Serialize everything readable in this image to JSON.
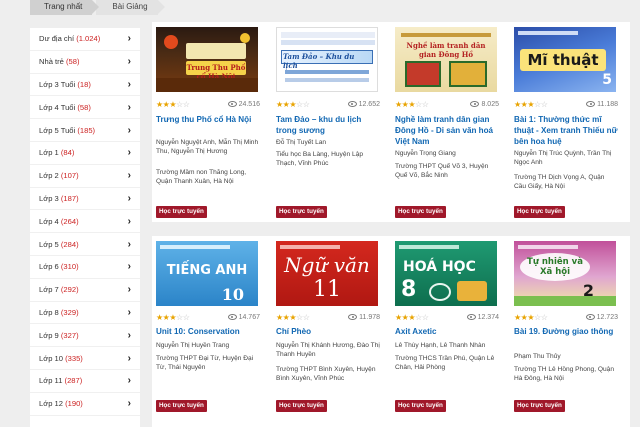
{
  "breadcrumb": {
    "home": "Trang nhất",
    "current": "Bài Giảng"
  },
  "sidebar": {
    "items": [
      {
        "label": "Dư địa chí",
        "count": "(1.024)"
      },
      {
        "label": "Nhà trẻ",
        "count": "(58)"
      },
      {
        "label": "Lớp 3 Tuổi",
        "count": "(18)"
      },
      {
        "label": "Lớp 4 Tuổi",
        "count": "(58)"
      },
      {
        "label": "Lớp 5 Tuổi",
        "count": "(185)"
      },
      {
        "label": "Lớp 1",
        "count": "(84)"
      },
      {
        "label": "Lớp 2",
        "count": "(107)"
      },
      {
        "label": "Lớp 3",
        "count": "(187)"
      },
      {
        "label": "Lớp 4",
        "count": "(264)"
      },
      {
        "label": "Lớp 5",
        "count": "(284)"
      },
      {
        "label": "Lớp 6",
        "count": "(310)"
      },
      {
        "label": "Lớp 7",
        "count": "(292)"
      },
      {
        "label": "Lớp 8",
        "count": "(329)"
      },
      {
        "label": "Lớp 9",
        "count": "(327)"
      },
      {
        "label": "Lớp 10",
        "count": "(335)"
      },
      {
        "label": "Lớp 11",
        "count": "(287)"
      },
      {
        "label": "Lớp 12",
        "count": "(190)"
      }
    ]
  },
  "button_label": "Học trực tuyến",
  "cards": [
    {
      "title": "Trưng thu Phố cổ Hà Nội",
      "authors": "Nguyễn Nguyệt Anh, Mẫn Thị Minh Thu, Nguyễn Thị Hương",
      "school": "Trường Mầm non Thăng Long, Quận Thanh Xuân, Hà Nội",
      "views": "24.516",
      "rating": 3,
      "thumb_text": "Trung Thu Phố cổ Hà Nội"
    },
    {
      "title": "Tam Đảo – khu du lịch trong sương",
      "authors": "Đỗ Thị Tuyết Lan",
      "school": "Tiểu học Ba Làng, Huyện Lập Thạch, Vĩnh Phúc",
      "views": "12.652",
      "rating": 3,
      "thumb_text": "Tam Đảo – Khu du lịch"
    },
    {
      "title": "Nghề làm tranh dân gian Đông Hồ - Di sản văn hoá Việt Nam",
      "authors": "Nguyễn Trọng Giang",
      "school": "Trường THPT Quế Võ 3, Huyện Quế Võ, Bắc Ninh",
      "views": "8.025",
      "rating": 3,
      "thumb_text": "Nghề làm tranh dân gian Đông Hồ"
    },
    {
      "title": "Bài 1: Thường thức mĩ thuật - Xem tranh Thiếu nữ bên hoa huệ",
      "authors": "Nguyễn Thị Trúc Quỳnh, Trần Thị Ngọc Anh",
      "school": "Trường TH Dịch Vọng A, Quận Cầu Giấy, Hà Nội",
      "views": "11.188",
      "rating": 3,
      "thumb_text": "Mĩ thuật"
    },
    {
      "title": "Unit 10: Conservation",
      "authors": "Nguyễn Thị Huyền Trang",
      "school": "Trường THPT Đại Từ, Huyện Đại Từ, Thái Nguyên",
      "views": "14.767",
      "rating": 3,
      "thumb_text": "TIẾNG ANH"
    },
    {
      "title": "Chí Phèo",
      "authors": "Nguyễn Thị Khánh Hương, Đào Thị Thanh Huyền",
      "school": "Trường THPT Bình Xuyên, Huyện Bình Xuyên, Vĩnh Phúc",
      "views": "11.978",
      "rating": 3,
      "thumb_text": "Ngữ văn"
    },
    {
      "title": "Axit Axetic",
      "authors": "Lê Thùy Hạnh, Lê Thanh Nhàn",
      "school": "Trường THCS Trần Phú, Quận Lê Chân, Hải Phòng",
      "views": "12.374",
      "rating": 3,
      "thumb_text": "HOÁ HỌC"
    },
    {
      "title": "Bài 19. Đường giao thông",
      "authors": "Phạm Thu Thủy",
      "school": "Trường TH Lê Hồng Phong, Quận Hà Đông, Hà Nội",
      "views": "12.723",
      "rating": 3,
      "thumb_text": "Tự nhiên và Xã hội"
    }
  ],
  "thumb_numbers": {
    "english": "10",
    "literature": "11",
    "chemistry": "8",
    "science": "2"
  }
}
